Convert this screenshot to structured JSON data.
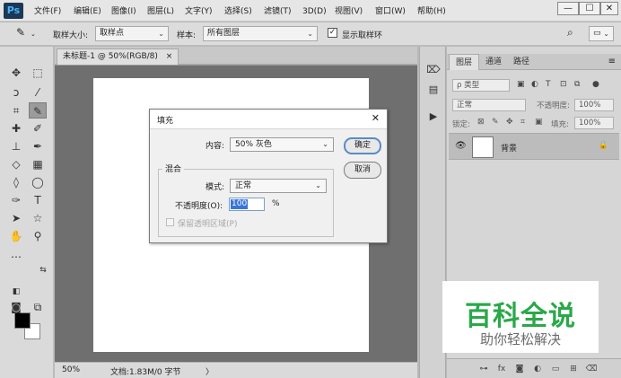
{
  "app": {
    "logo": "Ps"
  },
  "menubar": {
    "items": [
      "文件(F)",
      "编辑(E)",
      "图像(I)",
      "图层(L)",
      "文字(Y)",
      "选择(S)",
      "滤镜(T)",
      "3D(D)",
      "视图(V)",
      "窗口(W)",
      "帮助(H)"
    ],
    "window_controls": [
      "—",
      "☐",
      "✕"
    ]
  },
  "options_bar": {
    "sample_size_label": "取样大小:",
    "sample_size_value": "取样点",
    "sample_label": "样本:",
    "sample_value": "所有图层",
    "show_ring_label": "显示取样环",
    "show_ring_checked": "✓"
  },
  "document": {
    "tab_label": "未标题-1 @ 50%(RGB/8)",
    "tab_close": "×",
    "zoom": "50%",
    "doc_info": "文档:1.83M/0 字节",
    "status_arrow": "〉"
  },
  "fill_dialog": {
    "title": "填充",
    "close": "✕",
    "content_label": "内容:",
    "content_value": "50% 灰色",
    "blend_group": "混合",
    "mode_label": "模式:",
    "mode_value": "正常",
    "opacity_label": "不透明度(O):",
    "opacity_value": "100",
    "opacity_unit": "%",
    "preserve_label": "保留透明区域(P)",
    "ok_label": "确定",
    "cancel_label": "取消"
  },
  "layers_panel": {
    "tabs": [
      "图层",
      "通道",
      "路径"
    ],
    "kind_filter": "ρ 类型",
    "blend_mode": "正常",
    "opacity_label": "不透明度:",
    "opacity_value": "100%",
    "lock_label": "锁定:",
    "fill_label": "填充:",
    "fill_value": "100%",
    "layer_name": "背景"
  },
  "watermark": {
    "title": "百科全说",
    "subtitle": "助你轻松解决"
  },
  "colors": {
    "accent": "#3875d7",
    "ps_logo_bg": "#1b3855",
    "ps_logo_fg": "#46b1ff",
    "watermark_green": "#2aa84a"
  }
}
